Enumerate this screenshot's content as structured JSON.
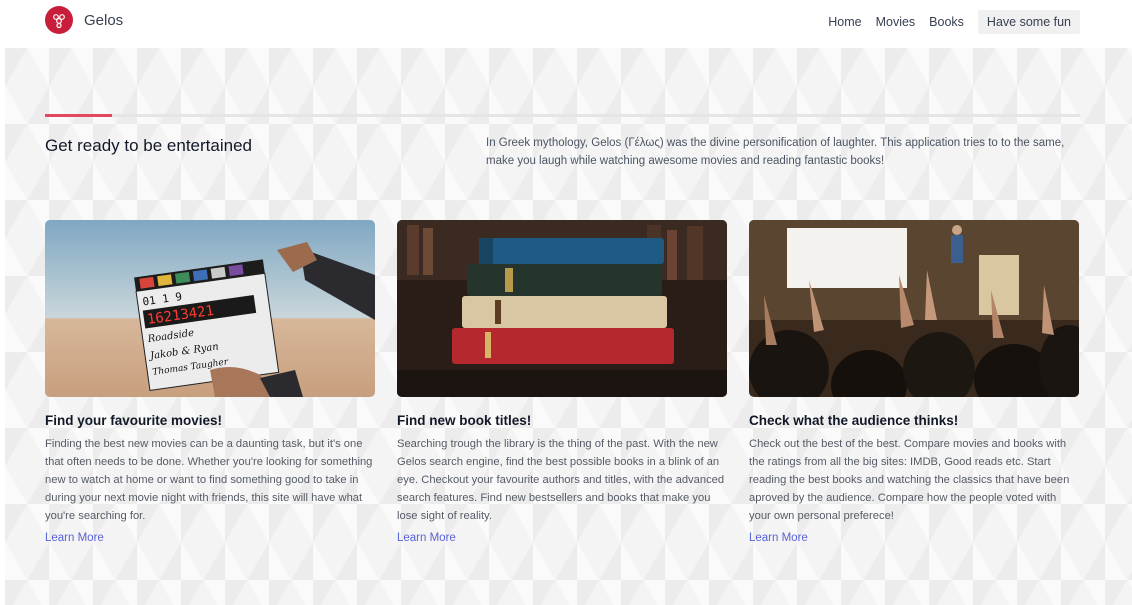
{
  "navbar": {
    "brand_name": "Gelos",
    "links": [
      "Home",
      "Movies",
      "Books"
    ],
    "cta": "Have some fun"
  },
  "hero": {
    "headline": "Get ready to be entertained",
    "intro": "In Greek mythology, Gelos (Γέλως) was the divine personification of laughter. This application tries to to the same, make you laugh while watching awesome movies and reading fantastic books!"
  },
  "cards": [
    {
      "image_icon": "clapperboard-photo",
      "title": "Find your favourite movies!",
      "text": "Finding the best new movies can be a daunting task, but it's one that often needs to be done. Whether you're looking for something new to watch at home or want to find something good to take in during your next movie night with friends, this site will have what you're searching for.",
      "link": "Learn More",
      "clapper": {
        "slate_row1": "01 1 9",
        "timecode": "16213421",
        "line1": "Roadside",
        "line2": "Jakob & Ryan",
        "line3": "Thomas Taugher"
      }
    },
    {
      "image_icon": "book-stack-photo",
      "title": "Find new book titles!",
      "text": "Searching trough the library is the thing of the past. With the new Gelos search engine, find the best possible books in a blink of an eye. Checkout your favourite authors and titles, with the advanced search features. Find new bestsellers and books that make you lose sight of reality.",
      "link": "Learn More"
    },
    {
      "image_icon": "applauding-audience-photo",
      "title": "Check what the audience thinks!",
      "text": "Check out the best of the best. Compare movies and books with the ratings from all the big sites: IMDB, Good reads etc. Start reading the best books and watching the classics that have been aproved by the audience. Compare how the people voted with your own personal preferece!",
      "link": "Learn More"
    }
  ],
  "colors": {
    "brand": "#c81e3c",
    "accent_rule": "#e24862",
    "link": "#5b62d6"
  }
}
